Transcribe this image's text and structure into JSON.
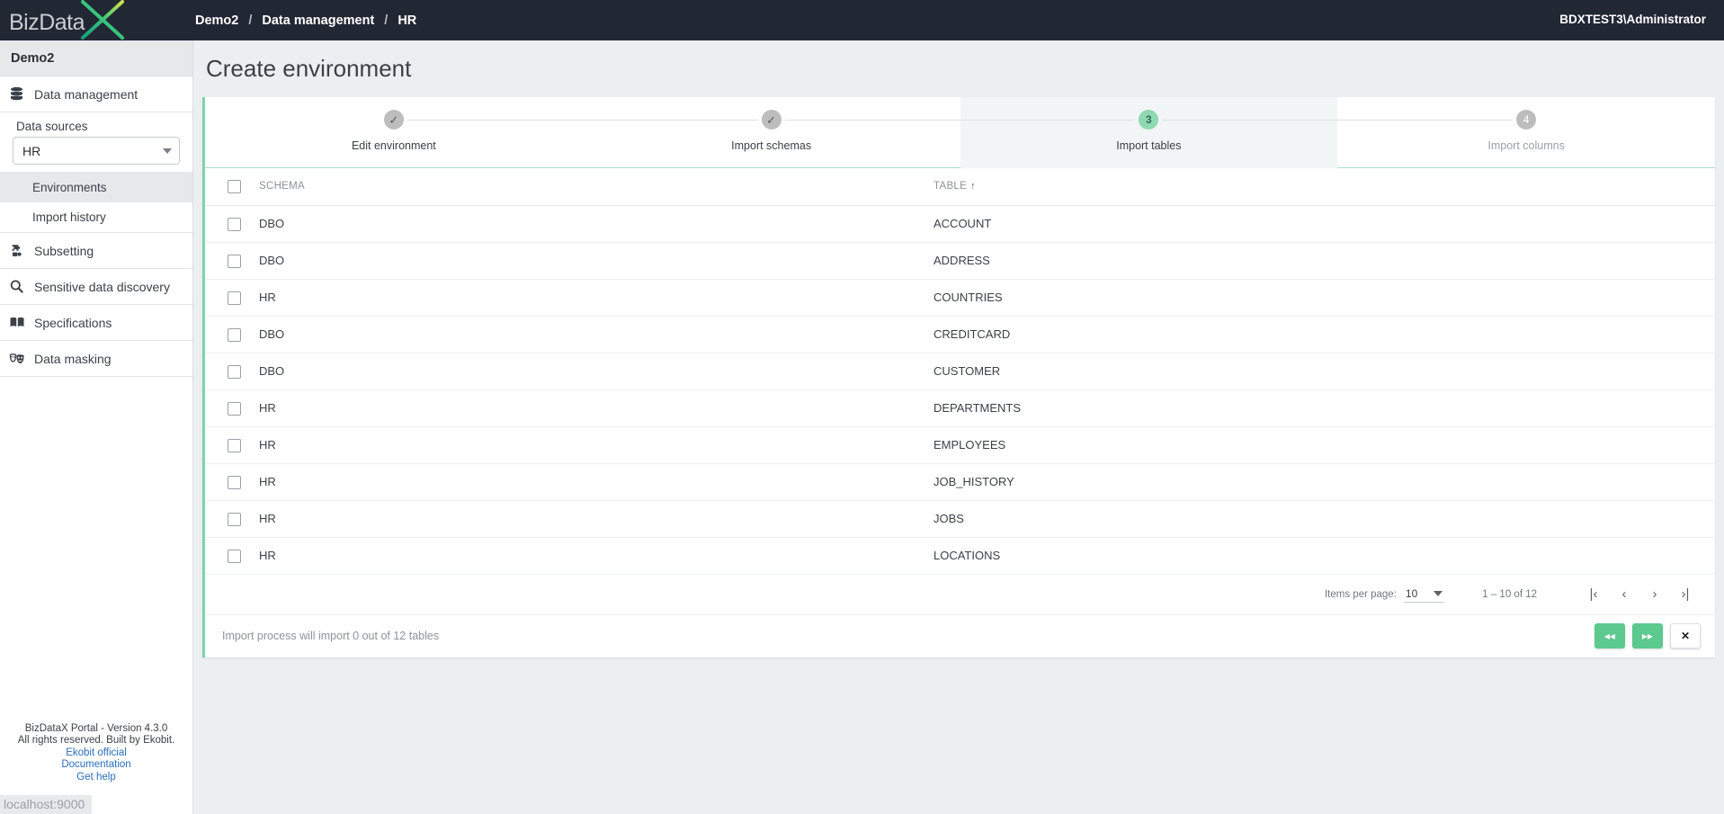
{
  "topbar": {
    "logo_text": "BizData",
    "logo_x": "X",
    "breadcrumb": [
      "Demo2",
      "Data management",
      "HR"
    ],
    "separator": "/",
    "user": "BDXTEST3\\Administrator"
  },
  "sidebar": {
    "title": "Demo2",
    "items": [
      {
        "label": "Data management",
        "icon": "database-icon"
      },
      {
        "label": "Subsetting",
        "icon": "puzzle-icon"
      },
      {
        "label": "Sensitive data discovery",
        "icon": "search-icon"
      },
      {
        "label": "Specifications",
        "icon": "book-icon"
      },
      {
        "label": "Data masking",
        "icon": "masks-icon"
      }
    ],
    "data_sources_label": "Data sources",
    "data_source_value": "HR",
    "subitems": [
      {
        "label": "Environments",
        "active": true
      },
      {
        "label": "Import history",
        "active": false
      }
    ],
    "footer": {
      "line1": "BizDataX Portal - Version 4.3.0",
      "line2": "All rights reserved. Built by Ekobit.",
      "links": [
        "Ekobit official",
        "Documentation",
        "Get help"
      ]
    },
    "statusbar": "localhost:9000"
  },
  "main": {
    "page_title": "Create environment",
    "steps": [
      {
        "label": "Edit environment",
        "marker": "✓",
        "state": "done"
      },
      {
        "label": "Import schemas",
        "marker": "✓",
        "state": "done"
      },
      {
        "label": "Import tables",
        "marker": "3",
        "state": "current"
      },
      {
        "label": "Import columns",
        "marker": "4",
        "state": "todo"
      }
    ],
    "table": {
      "columns": [
        "SCHEMA",
        "TABLE"
      ],
      "sorted_column": "TABLE",
      "sort_arrow": "↑",
      "rows": [
        {
          "schema": "DBO",
          "table": "ACCOUNT"
        },
        {
          "schema": "DBO",
          "table": "ADDRESS"
        },
        {
          "schema": "HR",
          "table": "COUNTRIES"
        },
        {
          "schema": "DBO",
          "table": "CREDITCARD"
        },
        {
          "schema": "DBO",
          "table": "CUSTOMER"
        },
        {
          "schema": "HR",
          "table": "DEPARTMENTS"
        },
        {
          "schema": "HR",
          "table": "EMPLOYEES"
        },
        {
          "schema": "HR",
          "table": "JOB_HISTORY"
        },
        {
          "schema": "HR",
          "table": "JOBS"
        },
        {
          "schema": "HR",
          "table": "LOCATIONS"
        }
      ]
    },
    "paginator": {
      "items_per_page_label": "Items per page:",
      "items_per_page_value": "10",
      "range_label": "1 – 10 of 12",
      "first_icon": "|‹",
      "prev_icon": "‹",
      "next_icon": "›",
      "last_icon": "›|"
    },
    "actions": {
      "note": "Import process will import 0 out of 12 tables",
      "back_label": "◂◂",
      "forward_label": "▸▸",
      "close_label": "✕"
    }
  },
  "colors": {
    "topbar_bg": "#212733",
    "accent_green": "#5cc98f",
    "card_border": "#7fd4a8",
    "step_current": "#8fd9b2",
    "step_done": "#bdbdbd",
    "link": "#2a6ebb"
  }
}
